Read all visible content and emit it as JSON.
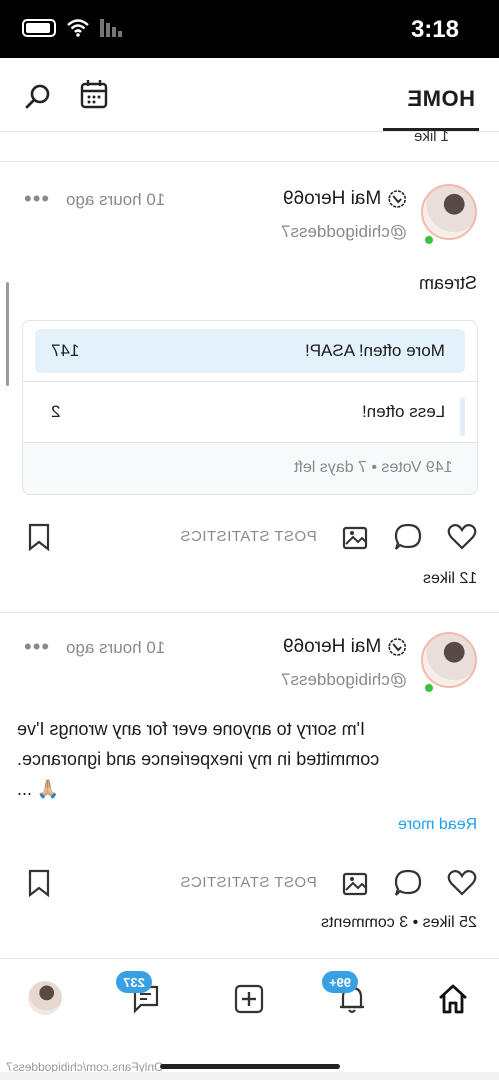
{
  "status_bar": {
    "time": "3:18"
  },
  "header": {
    "title": "HOME"
  },
  "feed_top_cut": {
    "text": "1 like"
  },
  "posts": [
    {
      "author": "Mai Hero69",
      "handle": "@chibigoddess7",
      "time": "10 hours ago",
      "text": "Stream",
      "poll": {
        "options": [
          {
            "label": "More often! ASAP!",
            "count": "147"
          },
          {
            "label": "Less often!",
            "count": "2"
          }
        ],
        "footer": "149 Votes • 7 days left"
      },
      "stats_label": "POST STATISTICS",
      "likes": "12 likes"
    },
    {
      "author": "Mai Hero69",
      "handle": "@chibigoddess7",
      "time": "10 hours ago",
      "text_lines": [
        "I'm sorry to anyone ever for any wrongs I've",
        "committed in my inexperience and ignorance.",
        "🙏🏼 ..."
      ],
      "read_more": "Read more",
      "stats_label": "POST STATISTICS",
      "likes": "25 likes • 3 comments"
    }
  ],
  "bottom_nav": {
    "notifications_badge": "99+",
    "messages_badge": "237"
  },
  "watermark": "OnlyFans.com/chibigoddess7",
  "colors": {
    "accent": "#1da1f2",
    "badge": "#3aa0e4",
    "online": "#3cc13b",
    "poll_highlight": "#e3f1fb"
  },
  "icons": [
    "search-icon",
    "calendar-icon",
    "more-icon",
    "verified-icon",
    "heart-icon",
    "comment-icon",
    "image-icon",
    "bookmark-icon",
    "home-icon",
    "bell-icon",
    "add-icon",
    "message-icon"
  ]
}
